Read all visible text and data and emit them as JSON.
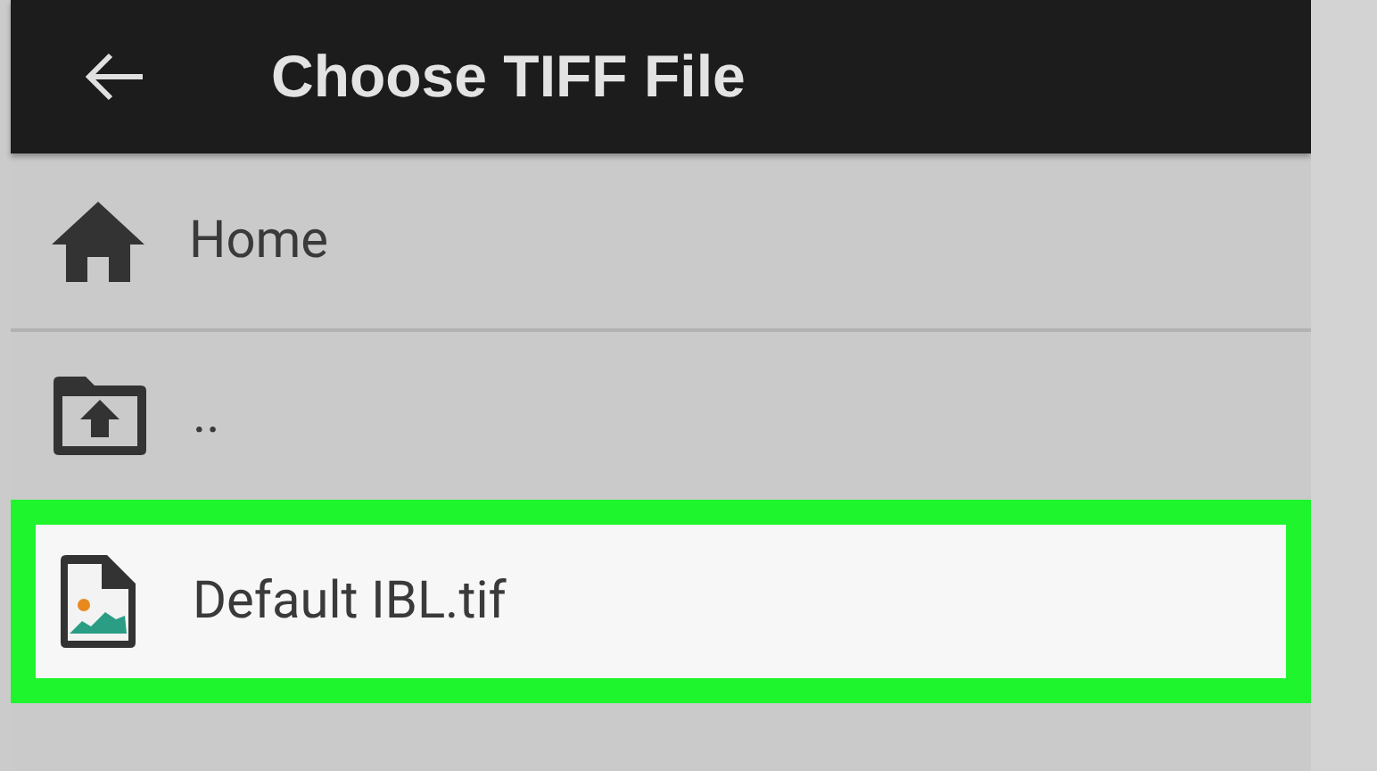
{
  "app_bar": {
    "title": "Choose TIFF File"
  },
  "items": [
    {
      "kind": "home",
      "label": "Home",
      "selected": false
    },
    {
      "kind": "parent",
      "label": "..",
      "selected": false
    },
    {
      "kind": "file",
      "label": "Default IBL.tif",
      "selected": true
    }
  ]
}
